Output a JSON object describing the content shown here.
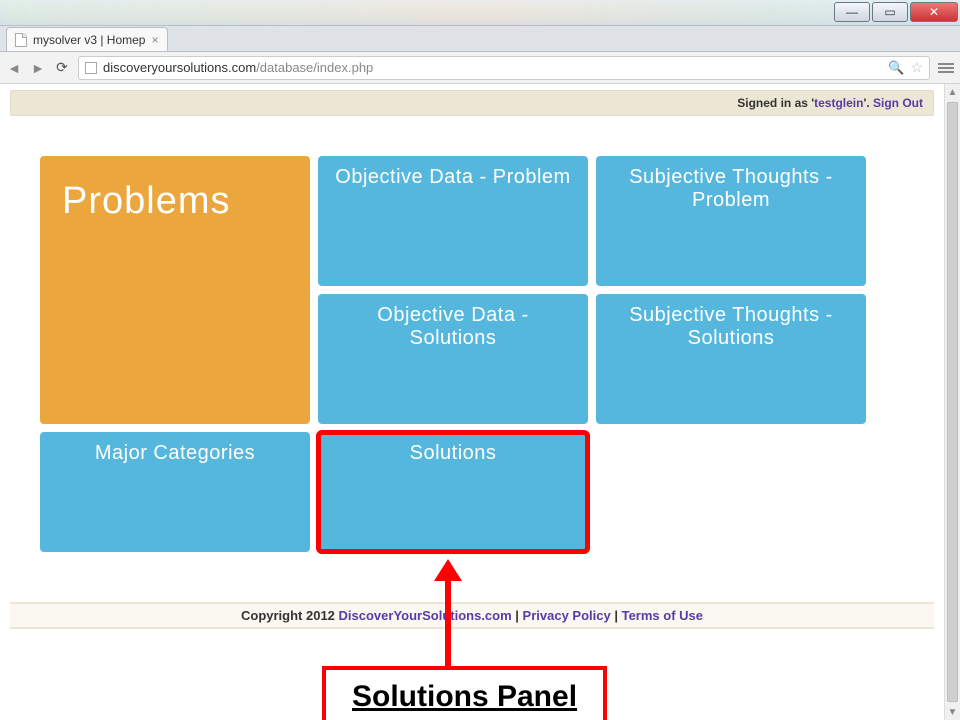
{
  "window": {
    "min": "—",
    "max": "▭",
    "close": "✕"
  },
  "tab": {
    "title": "mysolver v3 | Homep",
    "close": "×"
  },
  "address": {
    "host": "discoveryoursolutions.com",
    "path": "/database/index.php"
  },
  "login": {
    "prefix": "Signed in as '",
    "user": "testglein",
    "suffix": "'. ",
    "signout": "Sign Out"
  },
  "tiles": {
    "problems": "Problems",
    "obj_problem": "Objective Data - Problem",
    "subj_problem": "Subjective Thoughts - Problem",
    "obj_solutions": "Objective Data - Solutions",
    "subj_solutions": "Subjective Thoughts - Solutions",
    "major_categories": "Major Categories",
    "solutions": "Solutions"
  },
  "footer": {
    "copyright": "Copyright 2012 ",
    "site": "DiscoverYourSolutions.com",
    "sep": " | ",
    "privacy": "Privacy Policy",
    "terms": "Terms of Use"
  },
  "annotation": {
    "label": "Solutions Panel"
  }
}
